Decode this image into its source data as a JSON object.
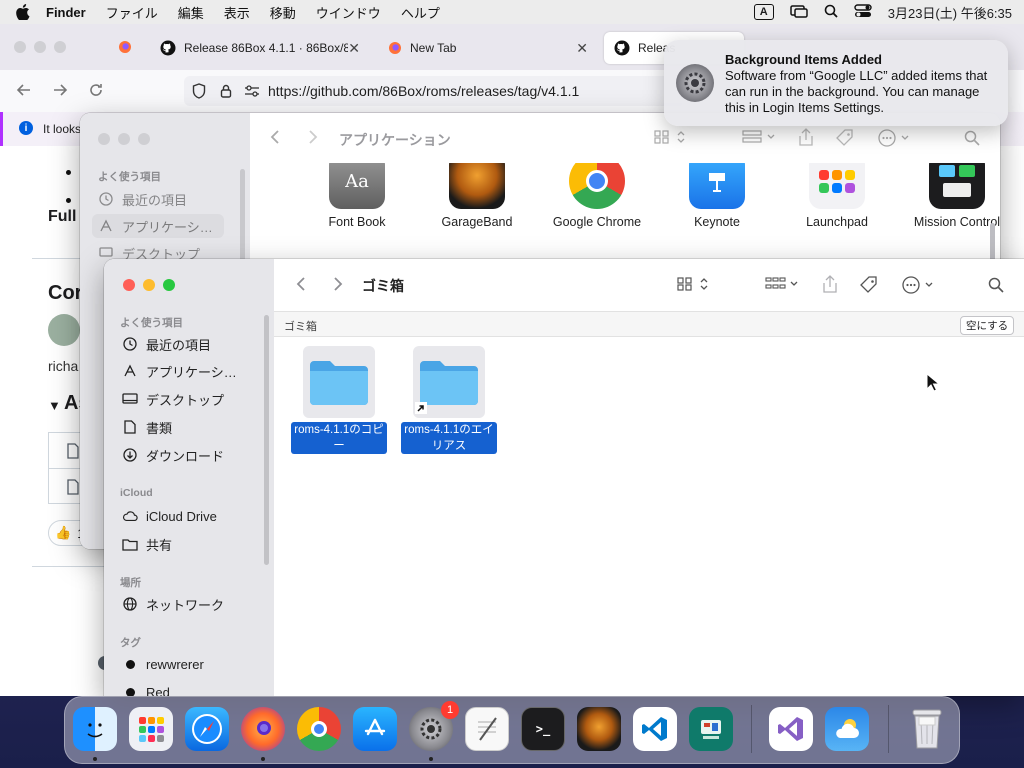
{
  "menubar": {
    "app_name": "Finder",
    "items": [
      "ファイル",
      "編集",
      "表示",
      "移動",
      "ウインドウ",
      "ヘルプ"
    ],
    "input_mode": "A",
    "clock": "3月23日(土) 午後6:35"
  },
  "browser": {
    "tabs": [
      {
        "label": "Release 86Box 4.1.1 · 86Box/86"
      },
      {
        "label": "New Tab"
      },
      {
        "label": "Releas"
      }
    ],
    "url": "https://github.com/86Box/roms/releases/tag/v4.1.1",
    "infobar_text": "It looks",
    "page": {
      "full_heading": "Full",
      "contrib_heading": "Cor",
      "user": "richa",
      "assets_heading": "As",
      "reaction_count": "1"
    }
  },
  "finder_back": {
    "title": "アプリケーション",
    "sidebar": {
      "favorites_header": "よく使う項目",
      "items": [
        "最近の項目",
        "アプリケーシ…",
        "デスクトップ"
      ]
    },
    "apps": [
      "Font Book",
      "GarageBand",
      "Google Chrome",
      "Keynote",
      "Launchpad",
      "Mission Control"
    ]
  },
  "finder_front": {
    "title": "ゴミ箱",
    "path_label": "ゴミ箱",
    "empty_button": "空にする",
    "sidebar": {
      "favorites_header": "よく使う項目",
      "favorites": [
        "最近の項目",
        "アプリケーシ…",
        "デスクトップ",
        "書類",
        "ダウンロード"
      ],
      "icloud_header": "iCloud",
      "icloud": [
        "iCloud Drive",
        "共有"
      ],
      "locations_header": "場所",
      "locations": [
        "ネットワーク"
      ],
      "tags_header": "タグ",
      "tags": [
        "rewwrerer",
        "Red"
      ]
    },
    "files": [
      {
        "label_line1": "roms-4.1.1のコピ",
        "label_line2": "ー"
      },
      {
        "label_line1": "roms-4.1.1のエイ",
        "label_line2": "リアス"
      }
    ]
  },
  "notification": {
    "title": "Background Items Added",
    "body": "Software from “Google LLC” added items that can run in the background. You can manage this in Login Items Settings."
  },
  "dock": {
    "apps": [
      "finder-icon",
      "launchpad-icon",
      "safari-icon",
      "firefox-icon",
      "chrome-icon",
      "app-store-icon",
      "system-settings-icon",
      "textedit-icon",
      "terminal-icon",
      "garageband-icon",
      "vscode-icon",
      "activity-icon",
      "visual-studio-icon",
      "weather-icon",
      "trash-icon"
    ],
    "settings_badge": "1"
  },
  "colors": {
    "selection_blue": "#1561d0",
    "folder_blue": "#5ab8f0",
    "close_red": "#ff5f57",
    "minimize_yellow": "#febc2e",
    "zoom_green": "#28c840"
  }
}
